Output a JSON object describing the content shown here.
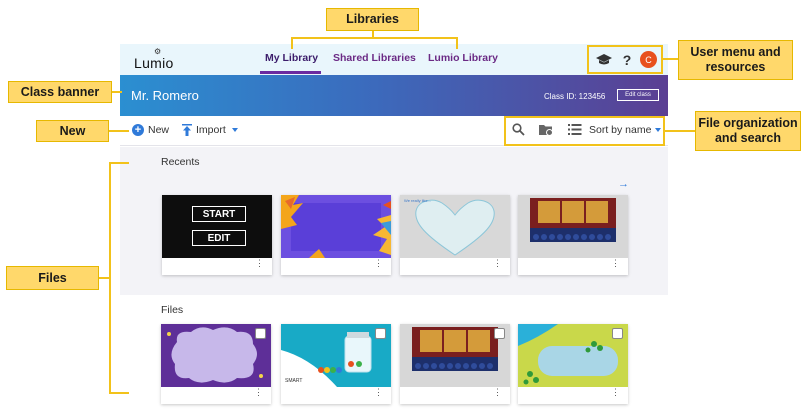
{
  "app": {
    "logo_text": "Lumio",
    "tabs": [
      {
        "label": "My Library",
        "active": true
      },
      {
        "label": "Shared Libraries",
        "active": false
      },
      {
        "label": "Lumio Library",
        "active": false
      }
    ],
    "avatar_initial": "C",
    "banner": {
      "teacher_name": "Mr. Romero",
      "class_id": "Class ID:  123456",
      "edit_label": "Edit class"
    },
    "toolbar": {
      "new_label": "New",
      "import_label": "Import",
      "sort_label": "Sort by name"
    },
    "recents": {
      "title": "Recents",
      "cards": [
        {
          "name": "start-edit-card",
          "buttons": [
            "START",
            "EDIT"
          ]
        },
        {
          "name": "floral-purple-card"
        },
        {
          "name": "heart-card",
          "caption": "We really like..."
        },
        {
          "name": "game-show-card"
        }
      ]
    },
    "files": {
      "title": "Files",
      "cards": [
        {
          "name": "purple-cloud-card"
        },
        {
          "name": "jar-card",
          "caption": "SMART"
        },
        {
          "name": "game-show-card-2"
        },
        {
          "name": "pond-card"
        }
      ]
    }
  },
  "annotations": {
    "libraries": "Libraries",
    "user_menu": "User menu and resources",
    "class_banner": "Class banner",
    "new": "New",
    "file_org": "File organization and search",
    "files": "Files"
  },
  "colors": {
    "accent": "#6b2aa0",
    "callout": "#ffd86b",
    "new_blue": "#2f7ad9",
    "avatar": "#e8501e"
  }
}
